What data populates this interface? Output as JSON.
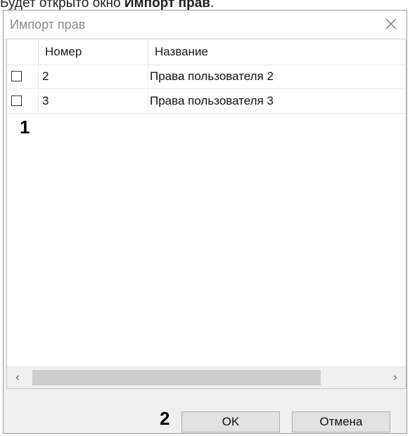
{
  "doc_text": {
    "prefix": "Будет открыто окно ",
    "bold": "Импорт прав",
    "suffix": "."
  },
  "dialog": {
    "title": "Импорт прав",
    "close_icon": "close-icon"
  },
  "table": {
    "headers": [
      "Номер",
      "Название"
    ],
    "rows": [
      {
        "checked": false,
        "number": "2",
        "name": "Права пользователя 2"
      },
      {
        "checked": false,
        "number": "3",
        "name": "Права пользователя 3"
      }
    ]
  },
  "markers": {
    "list": "1",
    "buttons": "2"
  },
  "scrollbar": {
    "left_arrow": "‹",
    "right_arrow": "›"
  },
  "buttons": {
    "ok": "OK",
    "cancel": "Отмена"
  }
}
